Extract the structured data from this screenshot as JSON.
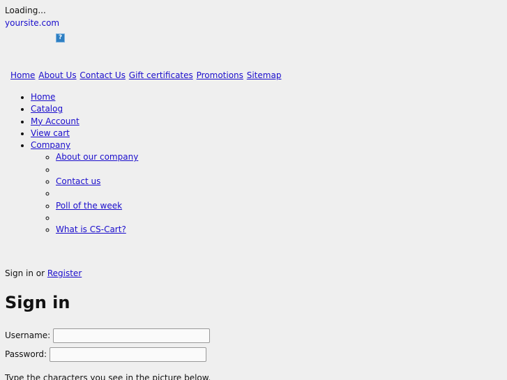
{
  "status": {
    "loading_text": "Loading..."
  },
  "site": {
    "name": "yoursite.com"
  },
  "help_icon": {
    "glyph": "?",
    "icon": "help-icon"
  },
  "topnav": {
    "items": [
      {
        "label": "Home"
      },
      {
        "label": "About Us"
      },
      {
        "label": "Contact Us"
      },
      {
        "label": "Gift certificates"
      },
      {
        "label": "Promotions"
      },
      {
        "label": "Sitemap"
      }
    ]
  },
  "mainmenu": {
    "items": [
      {
        "label": "Home"
      },
      {
        "label": "Catalog"
      },
      {
        "label": "My Account"
      },
      {
        "label": "View cart"
      },
      {
        "label": "Company"
      }
    ],
    "company_submenu": [
      {
        "label": "About our company"
      },
      {
        "label": ""
      },
      {
        "label": "Contact us"
      },
      {
        "label": ""
      },
      {
        "label": "Poll of the week"
      },
      {
        "label": ""
      },
      {
        "label": "What is CS-Cart?"
      }
    ]
  },
  "signin": {
    "prefix_text": "Sign in or ",
    "register_link": "Register",
    "heading": "Sign in",
    "username_label": "Username:",
    "username_value": "",
    "password_label": "Password:",
    "password_value": "",
    "captcha_hint": "Type the characters you see in the picture below."
  }
}
